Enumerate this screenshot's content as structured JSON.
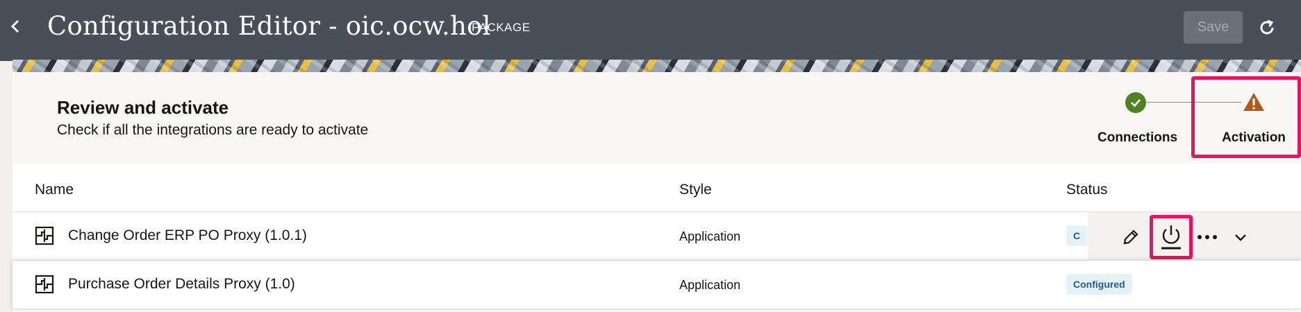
{
  "header": {
    "title": "Configuration Editor - oic.ocw.hol",
    "type_label": "PACKAGE",
    "save_label": "Save"
  },
  "review": {
    "title": "Review and activate",
    "subtitle": "Check if all the integrations are ready to activate"
  },
  "stepper": {
    "steps": [
      {
        "label": "Connections",
        "state": "complete",
        "icon": "check-icon"
      },
      {
        "label": "Activation",
        "state": "warning",
        "icon": "warning-icon"
      }
    ]
  },
  "table": {
    "columns": [
      "Name",
      "Style",
      "Status"
    ],
    "rows": [
      {
        "name": "Change Order ERP PO Proxy (1.0.1)",
        "style": "Application",
        "status": "C"
      },
      {
        "name": "Purchase Order Details Proxy (1.0)",
        "style": "Application",
        "status": "Configured"
      }
    ]
  },
  "colors": {
    "header_bg": "#4a4e56",
    "highlight": "#e8145f",
    "success": "#508223",
    "warning": "#b55718",
    "badge_bg": "#e4f1f7",
    "badge_text": "#1f5d86"
  },
  "icons": {
    "back": "chevron-left-icon",
    "refresh": "refresh-icon",
    "integration": "integration-icon",
    "edit": "pencil-icon",
    "activate": "power-icon",
    "more": "more-icon",
    "expand": "chevron-down-icon"
  }
}
